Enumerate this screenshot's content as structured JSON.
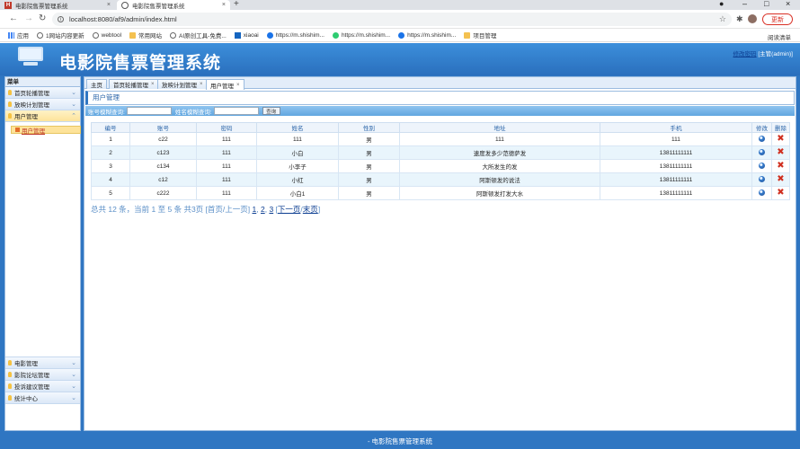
{
  "browser": {
    "tabs": [
      {
        "label": "电影院售票管理系统",
        "active": false
      },
      {
        "label": "电影院售票管理系统",
        "active": true
      }
    ],
    "new_tab": "+",
    "url": "localhost:8080/af9/admin/index.html",
    "update_label": "更新",
    "bookmarks": [
      {
        "label": "应用",
        "icon": "apps-grid-icon"
      },
      {
        "label": "1网站内容更新",
        "icon": "globe-icon"
      },
      {
        "label": "webtool",
        "icon": "globe-icon"
      },
      {
        "label": "常用网站",
        "icon": "folder-icon"
      },
      {
        "label": "AI原创工具-免费...",
        "icon": "globe-icon"
      },
      {
        "label": "xiaoai",
        "icon": "p-icon"
      },
      {
        "label": "https://m.shishim...",
        "icon": "c-icon"
      },
      {
        "label": "https://m.shishim...",
        "icon": "wechat-icon"
      },
      {
        "label": "https://m.shishim...",
        "icon": "c-icon"
      },
      {
        "label": "项目管理",
        "icon": "folder-icon"
      }
    ],
    "reading_list": "阅读清单"
  },
  "app": {
    "title": "电影院售票管理系统",
    "change_password": "修改密码",
    "user_label": "[主管(admin)]",
    "footer": "- 电影院售票管理系统"
  },
  "sidebar": {
    "header": "菜单",
    "top_items": [
      {
        "label": "首页轮播管理",
        "expanded": false
      },
      {
        "label": "放映计划管理",
        "expanded": false
      },
      {
        "label": "用户管理",
        "expanded": true
      }
    ],
    "sub_items": [
      {
        "label": "用户管理"
      }
    ],
    "bottom_items": [
      {
        "label": "电影管理"
      },
      {
        "label": "影院论坛管理"
      },
      {
        "label": "投诉建议管理"
      },
      {
        "label": "统计中心"
      }
    ]
  },
  "page_tabs": [
    {
      "label": "主页",
      "closable": false
    },
    {
      "label": "首页轮播管理",
      "closable": true
    },
    {
      "label": "放映计划管理",
      "closable": true
    },
    {
      "label": "用户管理",
      "closable": true
    }
  ],
  "panel": {
    "title": "用户管理",
    "search_account_label": "账号模糊查询:",
    "search_account_value": "",
    "search_name_label": "姓名模糊查询:",
    "search_name_value": "",
    "query_button": "查询"
  },
  "table": {
    "columns": [
      "编号",
      "账号",
      "密码",
      "姓名",
      "性别",
      "地址",
      "手机",
      "修改",
      "删除"
    ],
    "rows": [
      {
        "id": "1",
        "account": "c22",
        "password": "111",
        "name": "111",
        "gender": "男",
        "address": "111",
        "phone": "111"
      },
      {
        "id": "2",
        "account": "c123",
        "password": "111",
        "name": "小白",
        "gender": "男",
        "address": "速度发多少范德萨发",
        "phone": "13811111111"
      },
      {
        "id": "3",
        "account": "c134",
        "password": "111",
        "name": "小李子",
        "gender": "男",
        "address": "大所发生的发",
        "phone": "13811111111"
      },
      {
        "id": "4",
        "account": "c12",
        "password": "111",
        "name": "小红",
        "gender": "男",
        "address": "阿斯顿发的说法",
        "phone": "13811111111"
      },
      {
        "id": "5",
        "account": "c222",
        "password": "111",
        "name": "小白1",
        "gender": "男",
        "address": "阿斯顿发打发大水",
        "phone": "13811111111"
      }
    ]
  },
  "pagination": {
    "summary": "总共 12 条，当前 1 至 5 条 共3页 [首页/上一页]",
    "pages": [
      "1",
      "2",
      "3"
    ],
    "next": "下一页",
    "last": "末页"
  }
}
